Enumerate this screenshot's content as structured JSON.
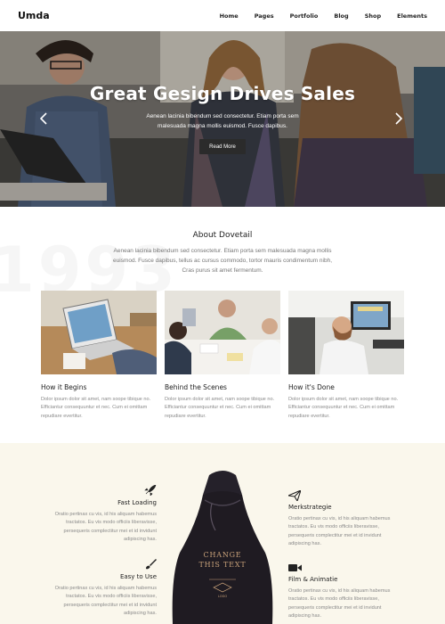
{
  "nav": {
    "logo": "Umda",
    "items": [
      "Home",
      "Pages",
      "Portfolio",
      "Blog",
      "Shop",
      "Elements"
    ]
  },
  "hero": {
    "title": "Great Gesign Drives Sales",
    "subtitle": "Aenean lacinia bibendum sed consectetur. Etiam porta sem malesuada magna mollis euismod. Fusce dapibus.",
    "button": "Read More",
    "prev_icon": "chevron-left-icon",
    "next_icon": "chevron-right-icon"
  },
  "about": {
    "title": "About Dovetail",
    "text": "Aenean lacinia bibendum sed consectetur. Etiam porta sem malesuada magna mollis euismod. Fusce dapibus, tellus ac cursus commodo, tortor mauris condimentum nibh, Cras purus sit amet fermentum.",
    "cards": [
      {
        "title": "How it Begins",
        "text": "Dolor ipsum dolor sit amet, nam soope tibique no. Efficiantur consequuntur et nec. Cum ei omittam repudiare evertitur."
      },
      {
        "title": "Behind the Scenes",
        "text": "Dolor ipsum dolor sit amet, nam soope tibique no. Efficiantur consequuntur et nec. Cum ei omittam repudiare evertitur."
      },
      {
        "title": "How it's Done",
        "text": "Dolor ipsum dolor sit amet, nam soope tibique no. Efficiantur consequuntur et nec. Cum ei omittam repudiare evertitur."
      }
    ]
  },
  "features": {
    "items": [
      {
        "title": "Fast Loading",
        "icon": "rocket-icon",
        "text": "Oratio pertinax cu vis, id his aliquam habemus tractatos. Eu vis modo officiis liberavisse, persequeris complectitur mei et id invidunt adipiscing has."
      },
      {
        "title": "Easy to Use",
        "icon": "brush-icon",
        "text": "Oratio pertinax cu vis, id his aliquam habemus tractatos. Eu vis modo officiis liberavisse, persequeris complectitur mei et id invidunt adipiscing has."
      },
      {
        "title": "Merkstrategie",
        "icon": "paper-plane-icon",
        "text": "Oratio pertinax cu vis, id his aliquam habemus tractatos. Eu vis modo officiis liberavisse, persequeris complectitur mei et id invidunt adipiscing has."
      },
      {
        "title": "Film & Animatie",
        "icon": "video-camera-icon",
        "text": "Oratio pertinax cu vis, id his aliquam habemus tractatos. Eu vis modo officiis liberavisse, persequeris complectitur mei et id invidunt adipiscing has."
      }
    ],
    "bag_text": "CHANGE THIS TEXT",
    "bag_label": "LOGO"
  },
  "colors": {
    "hero_button": "#2b2b2b",
    "features_bg": "#faf7ec",
    "bag": "#1f1b22",
    "bag_print": "#c9a27a"
  }
}
